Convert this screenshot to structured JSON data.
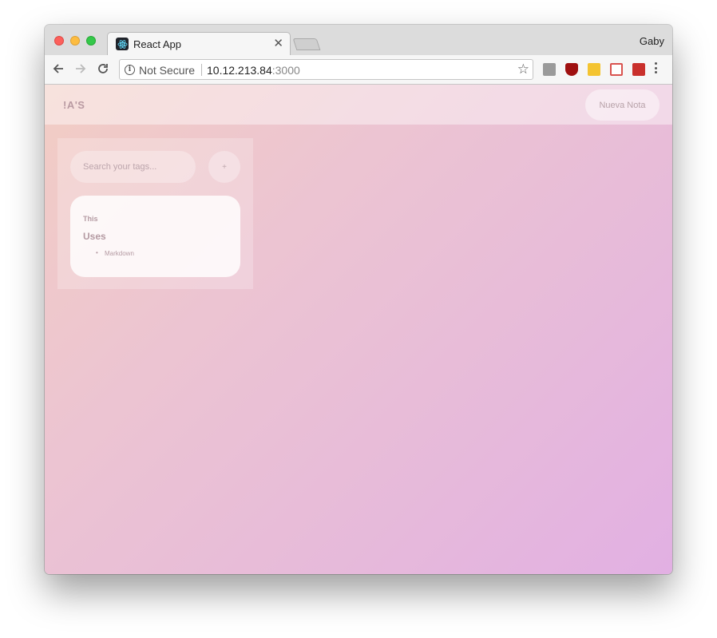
{
  "browser": {
    "tab_title": "React App",
    "profile_name": "Gaby",
    "security_label": "Not Secure",
    "url_host": "10.12.213.84",
    "url_port": ":3000",
    "icons": [
      "back-icon",
      "forward-icon",
      "reload-icon",
      "info-icon",
      "star-icon",
      "menu-icon"
    ]
  },
  "app": {
    "logo": "!A'S",
    "new_note_label": "Nueva Nota",
    "search_placeholder": "Search your tags...",
    "add_label": "+",
    "note": {
      "heading_small": "This",
      "heading": "Uses",
      "list_items": [
        "Markdown"
      ]
    }
  },
  "colors": {
    "bg_gradient_start": "#f2cdc4",
    "bg_gradient_end": "#e2b0e3",
    "text_muted": "#b49aa2"
  }
}
